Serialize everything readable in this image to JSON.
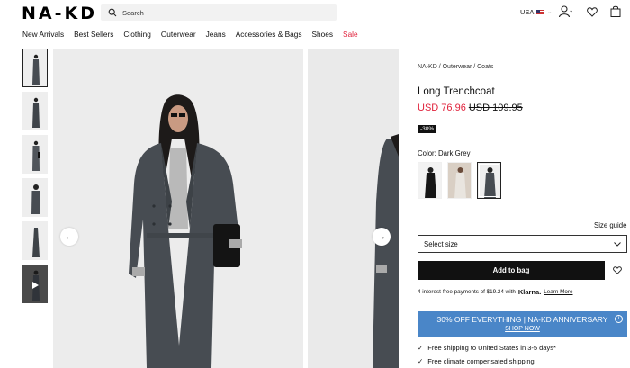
{
  "header": {
    "logo": "NA-KD",
    "search_placeholder": "Search",
    "locale": "USA"
  },
  "nav": {
    "items": [
      "New Arrivals",
      "Best Sellers",
      "Clothing",
      "Outerwear",
      "Jeans",
      "Accessories & Bags",
      "Shoes",
      "Sale"
    ]
  },
  "product": {
    "breadcrumb": "NA-KD / Outerwear / Coats",
    "title": "Long Trenchcoat",
    "price_now": "USD 76.96",
    "price_was": "USD 109.95",
    "discount_badge": "-30%",
    "color_label": "Color: Dark Grey",
    "size_guide": "Size guide",
    "size_select": "Select size",
    "add_to_bag": "Add to bag",
    "klarna_text": "4 interest-free payments of $19.24 with",
    "klarna_brand": "Klarna.",
    "klarna_link": "Learn More"
  },
  "promo": {
    "title": "30% OFF EVERYTHING | NA-KD ANNIVERSARY",
    "link": "SHOP NOW"
  },
  "shipping": [
    "Free shipping to United States in 3-5 days*",
    "Free climate compensated shipping"
  ],
  "colors": {
    "sale_red": "#e0213b",
    "promo_blue": "#4a86c8",
    "coat_grey": "#474c52"
  }
}
